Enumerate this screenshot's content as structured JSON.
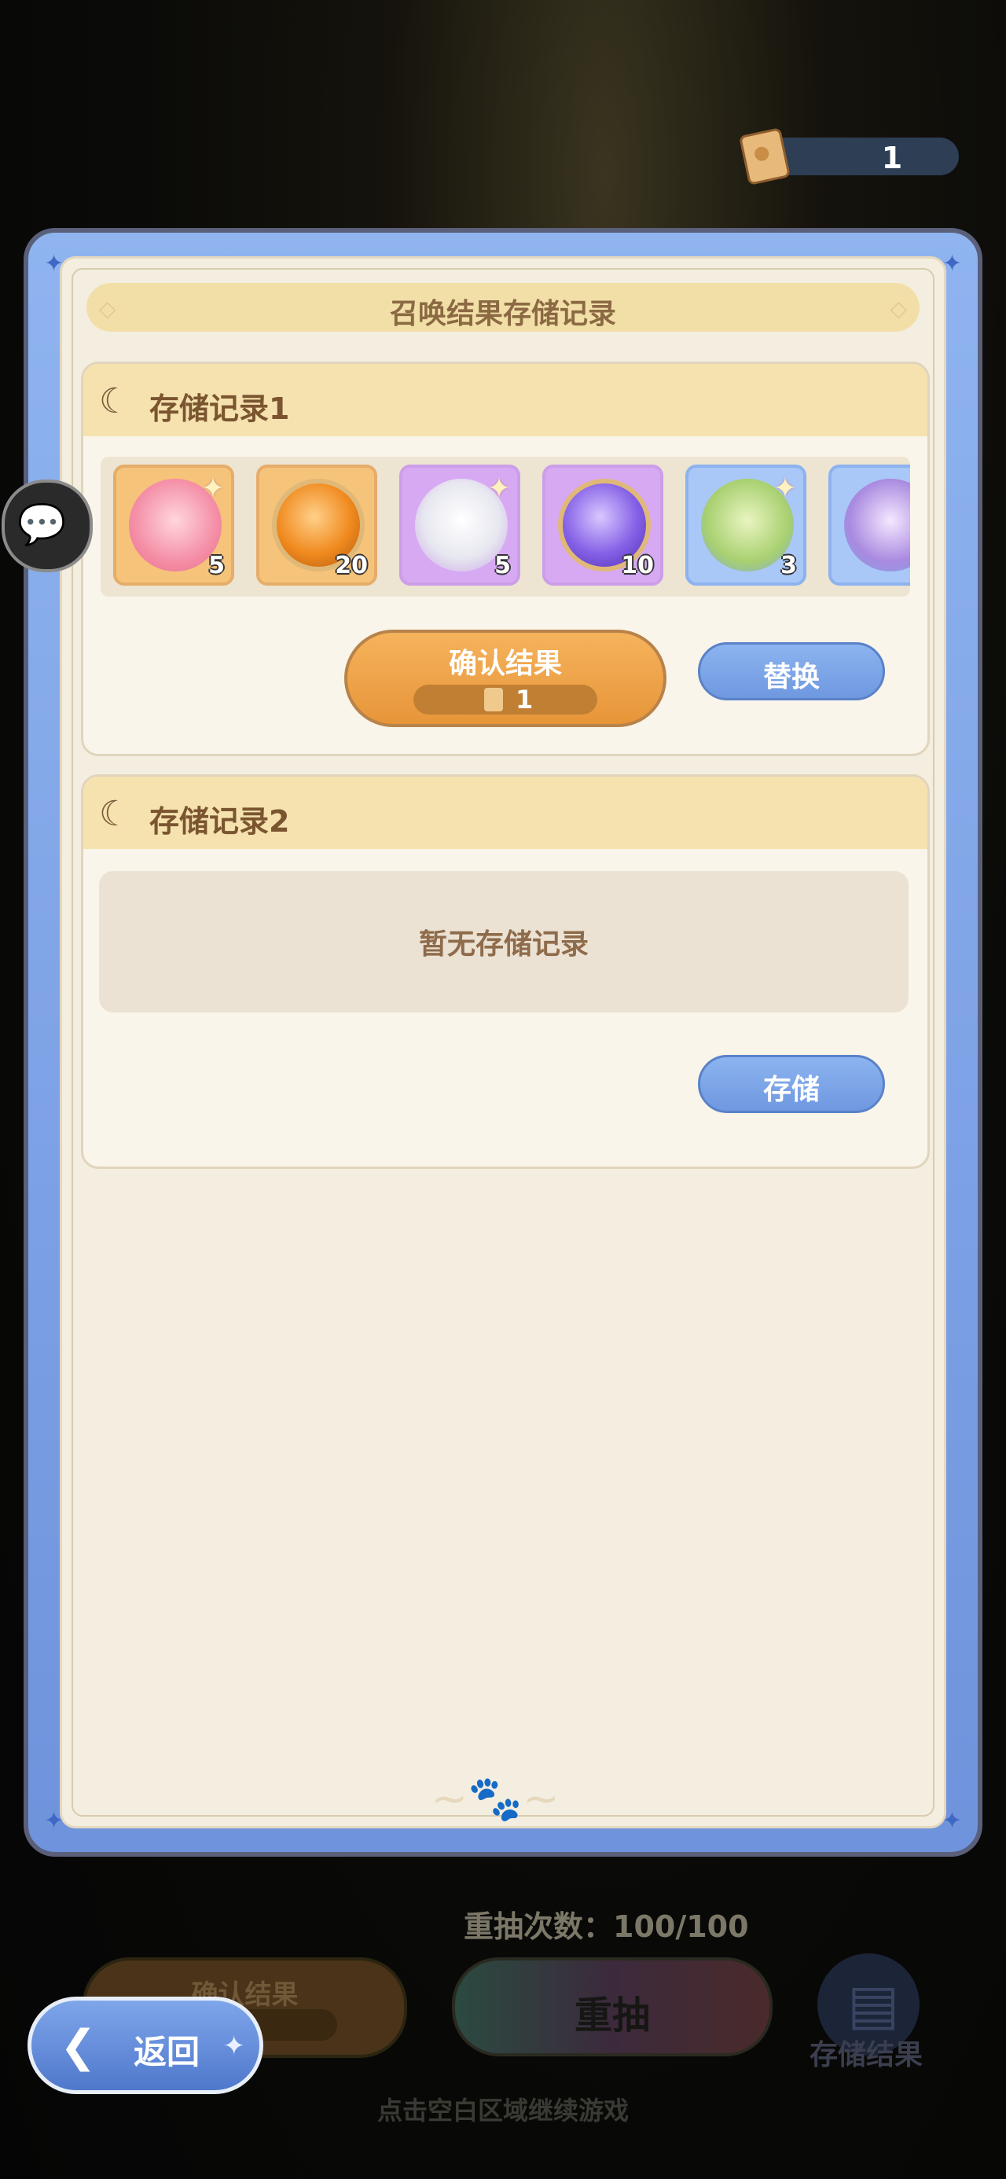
{
  "currency": {
    "value": "1",
    "icon": "ticket-icon"
  },
  "modal": {
    "title": "召唤结果存储记录",
    "records": [
      {
        "label": "存储记录1",
        "items": [
          {
            "icon": "character-pink-hair-icon",
            "count": "5",
            "rarity": "gold"
          },
          {
            "icon": "orange-cat-orb-icon",
            "count": "20",
            "rarity": "gold"
          },
          {
            "icon": "character-white-bird-icon",
            "count": "5",
            "rarity": "purple"
          },
          {
            "icon": "purple-cat-orb-icon",
            "count": "10",
            "rarity": "purple"
          },
          {
            "icon": "character-green-dragon-icon",
            "count": "3",
            "rarity": "blue"
          },
          {
            "icon": "character-purple-creature-icon",
            "count": "",
            "rarity": "blue"
          }
        ],
        "confirm_label": "确认结果",
        "confirm_cost": "1",
        "replace_label": "替换"
      },
      {
        "label": "存储记录2",
        "empty_text": "暂无存储记录",
        "store_label": "存储"
      }
    ]
  },
  "background": {
    "retry_count": "重抽次数：100/100",
    "confirm_label": "确认结果",
    "redraw_label": "重抽",
    "store_result_label": "存储结果",
    "hint": "点击空白区域继续游戏"
  },
  "back_label": "返回"
}
